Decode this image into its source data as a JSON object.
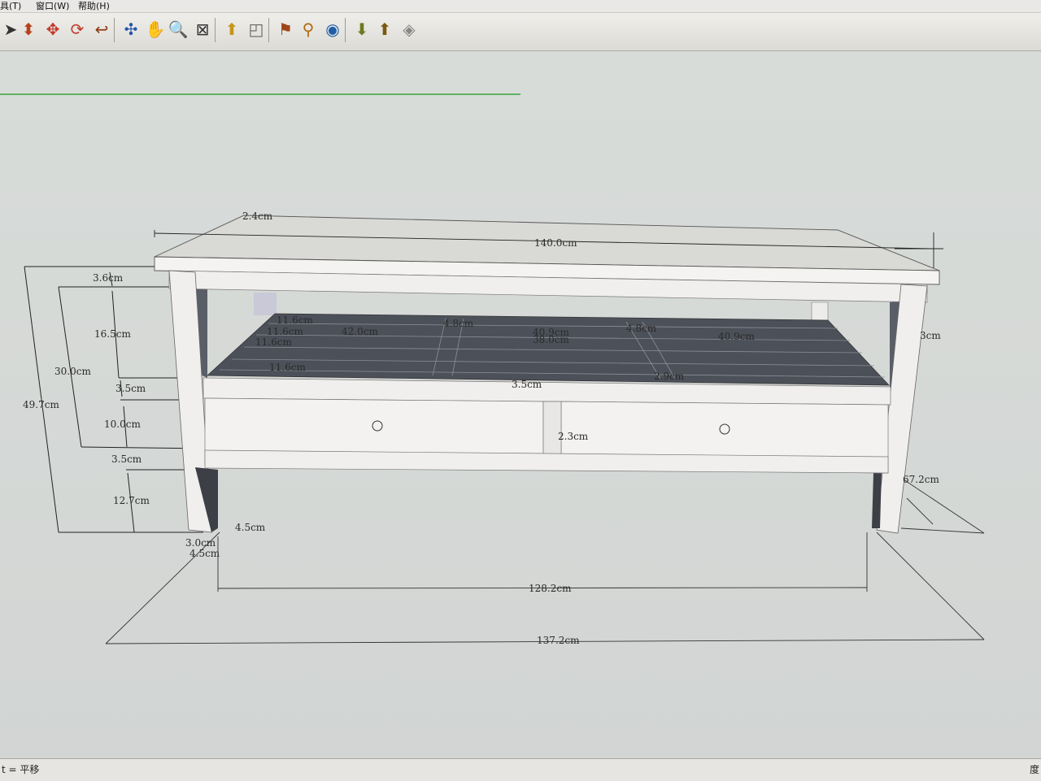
{
  "menubar": {
    "items": [
      "具(T)",
      "窗口(W)",
      "帮助(H)"
    ]
  },
  "toolbar": {
    "tools": [
      {
        "icon": "select-icon",
        "glyph": "➤",
        "color": "#333"
      },
      {
        "icon": "push-pull-icon",
        "glyph": "⬍",
        "color": "#b8401c"
      },
      {
        "icon": "move-icon",
        "glyph": "✥",
        "color": "#c0392b"
      },
      {
        "icon": "rotate-icon",
        "glyph": "⟳",
        "color": "#c0392b"
      },
      {
        "icon": "follow-me-icon",
        "glyph": "↩",
        "color": "#8a3b12"
      },
      {
        "icon": "orbit-icon",
        "glyph": "✣",
        "color": "#2255aa"
      },
      {
        "icon": "pan-icon",
        "glyph": "✋",
        "color": "#444"
      },
      {
        "icon": "zoom-icon",
        "glyph": "🔍",
        "color": "#333"
      },
      {
        "icon": "zoom-extents-icon",
        "glyph": "⊠",
        "color": "#333"
      },
      {
        "icon": "previous-view-icon",
        "glyph": "⬆",
        "color": "#c7961a"
      },
      {
        "icon": "next-view-icon",
        "glyph": "◰",
        "color": "#666"
      },
      {
        "icon": "position-camera-icon",
        "glyph": "⚑",
        "color": "#a0441a"
      },
      {
        "icon": "walk-icon",
        "glyph": "⚲",
        "color": "#b06a10"
      },
      {
        "icon": "look-around-icon",
        "glyph": "◉",
        "color": "#1f5fa8"
      },
      {
        "icon": "get-models-icon",
        "glyph": "⬇",
        "color": "#6b7a20"
      },
      {
        "icon": "share-model-icon",
        "glyph": "⬆",
        "color": "#7a5a10"
      },
      {
        "icon": "share-component-icon",
        "glyph": "◈",
        "color": "#888"
      }
    ]
  },
  "dimensions": {
    "top_width": "140.0cm",
    "top_depth": "2.4cm",
    "top_thickness": "3.6cm",
    "upper_gap": "16.5cm",
    "shelf_height": "30.0cm",
    "shelf_rail": "3.5cm",
    "total_height": "49.7cm",
    "drawer_height": "10.0cm",
    "lower_rail": "3.5cm",
    "leg_height": "12.7cm",
    "leg_width": "4.5cm",
    "leg_depth_a": "3.0cm",
    "leg_depth_b": "4.5cm",
    "slat_1": "11.6cm",
    "slat_2": "11.6cm",
    "slat_3": "11.6cm",
    "slat_4": "11.6cm",
    "slat_w1": "42.0cm",
    "slat_w2": "40.9cm",
    "slat_w3": "42.0cm",
    "slat_gap_a": "4.8cm",
    "slat_gap_b": "4.8cm",
    "slat_mid": "40.9cm",
    "slat_mid2": "38.0cm",
    "slat_small": "2.9cm",
    "front_rail": "3.5cm",
    "side_depth": "3cm",
    "drawer_divider": "2.3cm",
    "side_length": "67.2cm",
    "inner_span": "128.2cm",
    "outer_span": "137.2cm"
  },
  "status": {
    "text": "t = 平移",
    "right": "度"
  },
  "colors": {
    "wood": "#f1efed",
    "shelf": "#4c5059",
    "green_axis": "#3aa53a"
  }
}
